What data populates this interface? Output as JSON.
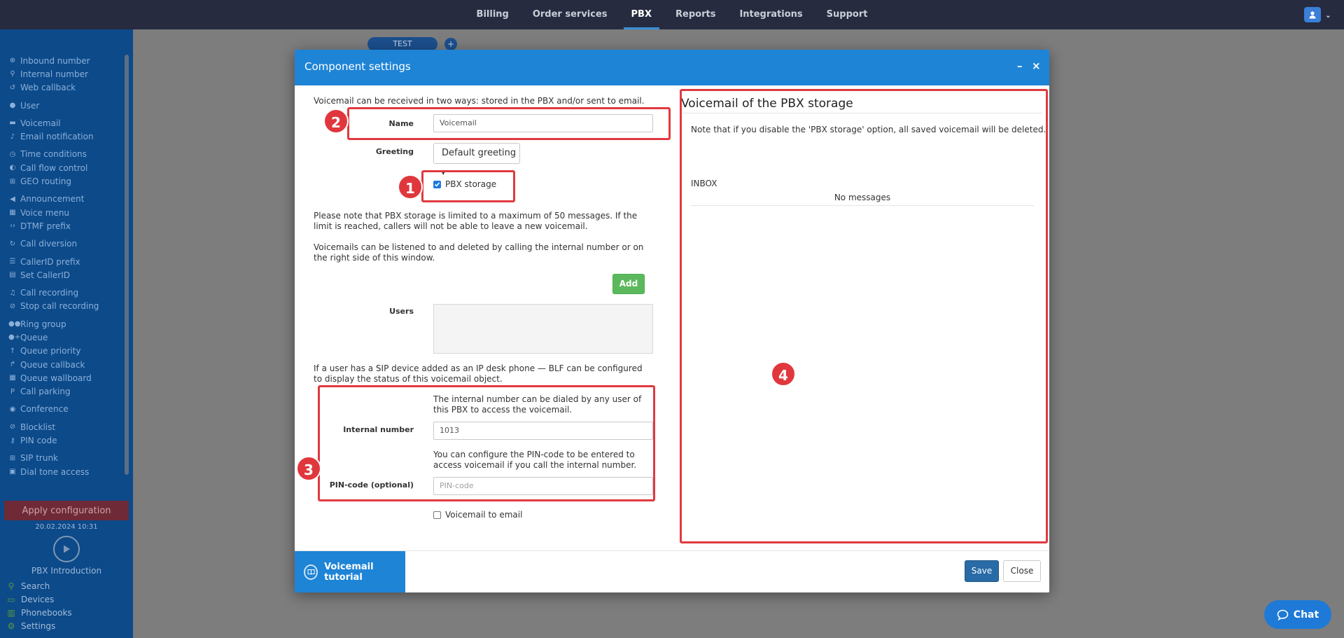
{
  "topnav": {
    "items": [
      "Billing",
      "Order services",
      "PBX",
      "Reports",
      "Integrations",
      "Support"
    ],
    "active": "PBX"
  },
  "sidebar": {
    "groups": [
      [
        {
          "icon": "plus-circle-icon",
          "glyph": "⊕",
          "label": "Inbound number"
        },
        {
          "icon": "map-pin-icon",
          "glyph": "⚲",
          "label": "Internal number"
        },
        {
          "icon": "callback-icon",
          "glyph": "↺",
          "label": "Web callback"
        }
      ],
      [
        {
          "icon": "user-icon",
          "glyph": "●",
          "label": "User"
        }
      ],
      [
        {
          "icon": "voicemail-icon",
          "glyph": "▬",
          "label": "Voicemail"
        },
        {
          "icon": "bell-icon",
          "glyph": "♪",
          "label": "Email notification"
        }
      ],
      [
        {
          "icon": "clock-icon",
          "glyph": "◷",
          "label": "Time conditions"
        },
        {
          "icon": "toggle-icon",
          "glyph": "◐",
          "label": "Call flow control"
        },
        {
          "icon": "sitemap-icon",
          "glyph": "⊞",
          "label": "GEO routing"
        }
      ],
      [
        {
          "icon": "megaphone-icon",
          "glyph": "◀",
          "label": "Announcement"
        },
        {
          "icon": "menu-grid-icon",
          "glyph": "▦",
          "label": "Voice menu"
        },
        {
          "icon": "code-icon",
          "glyph": "‹›",
          "label": "DTMF prefix"
        }
      ],
      [
        {
          "icon": "redo-icon",
          "glyph": "↻",
          "label": "Call diversion"
        }
      ],
      [
        {
          "icon": "list-icon",
          "glyph": "☰",
          "label": "CallerID prefix"
        },
        {
          "icon": "table-icon",
          "glyph": "▤",
          "label": "Set CallerID"
        }
      ],
      [
        {
          "icon": "microphone-icon",
          "glyph": "♫",
          "label": "Call recording"
        },
        {
          "icon": "microphone-slash-icon",
          "glyph": "⊘",
          "label": "Stop call recording"
        }
      ],
      [
        {
          "icon": "users-icon",
          "glyph": "●●",
          "label": "Ring group"
        },
        {
          "icon": "user-plus-icon",
          "glyph": "●+",
          "label": "Queue"
        },
        {
          "icon": "arrow-up-icon",
          "glyph": "↑",
          "label": "Queue priority"
        },
        {
          "icon": "share-icon",
          "glyph": "↱",
          "label": "Queue callback"
        },
        {
          "icon": "wallboard-icon",
          "glyph": "▦",
          "label": "Queue wallboard"
        },
        {
          "icon": "parking-icon",
          "glyph": "P",
          "label": "Call parking"
        }
      ],
      [
        {
          "icon": "comments-icon",
          "glyph": "◉",
          "label": "Conference"
        }
      ],
      [
        {
          "icon": "ban-icon",
          "glyph": "⊘",
          "label": "Blocklist"
        },
        {
          "icon": "key-icon",
          "glyph": "⚷",
          "label": "PIN code"
        }
      ],
      [
        {
          "icon": "sitemap-icon",
          "glyph": "⊞",
          "label": "SIP trunk"
        },
        {
          "icon": "lock-icon",
          "glyph": "▣",
          "label": "Dial tone access"
        }
      ]
    ],
    "apply_label": "Apply configuration",
    "apply_date": "20.02.2024 10:31",
    "intro_label": "PBX Introduction",
    "bottom_links": [
      {
        "icon": "search-icon",
        "glyph": "⚲",
        "label": "Search"
      },
      {
        "icon": "devices-icon",
        "glyph": "▭",
        "label": "Devices"
      },
      {
        "icon": "phonebook-icon",
        "glyph": "▥",
        "label": "Phonebooks"
      },
      {
        "icon": "gear-icon",
        "glyph": "⚙",
        "label": "Settings"
      }
    ]
  },
  "canvas": {
    "tab_label": "TEST"
  },
  "modal": {
    "title": "Component settings",
    "intro": "Voicemail can be received in two ways: stored in the PBX and/or sent to email.",
    "name_label": "Name",
    "name_value": "Voicemail",
    "greeting_label": "Greeting",
    "greeting_value": "Default greeting",
    "pbx_storage_label": "PBX storage",
    "storage_note": "Please note that PBX storage is limited to a maximum of 50 messages. If the limit is reached, callers will not be able to leave a new voicemail.",
    "listen_note": "Voicemails can be listened to and deleted by calling the internal number or on the right side of this window.",
    "add_label": "Add",
    "users_label": "Users",
    "blf_note": "If a user has a SIP device added as an IP desk phone — BLF can be configured to display the status of this voicemail object.",
    "internal_help": "The internal number can be dialed by any user of this PBX to access the voicemail.",
    "internal_label": "Internal number",
    "internal_value": "1013",
    "pin_help": "You can configure the PIN-code to be entered to access voicemail if you call the internal number.",
    "pin_label": "PIN-code (optional)",
    "pin_placeholder": "PIN-code",
    "vm_email_label": "Voicemail to email",
    "right_title": "Voicemail of the PBX storage",
    "right_note": "Note that if you disable the 'PBX storage' option, all saved voicemail will be deleted.",
    "inbox_label": "INBOX",
    "no_messages": "No messages",
    "tutorial_label": "Voicemail tutorial",
    "save_label": "Save",
    "close_label": "Close"
  },
  "annotations": [
    "1",
    "2",
    "3",
    "4"
  ],
  "chat_label": "Chat",
  "colors": {
    "topbar": "#262b3f",
    "sidebar": "#0c4a8a",
    "modal_header": "#1e84d6",
    "annotation_red": "#e03a3f",
    "add_green": "#5cb85c",
    "save_blue": "#286ba6"
  }
}
